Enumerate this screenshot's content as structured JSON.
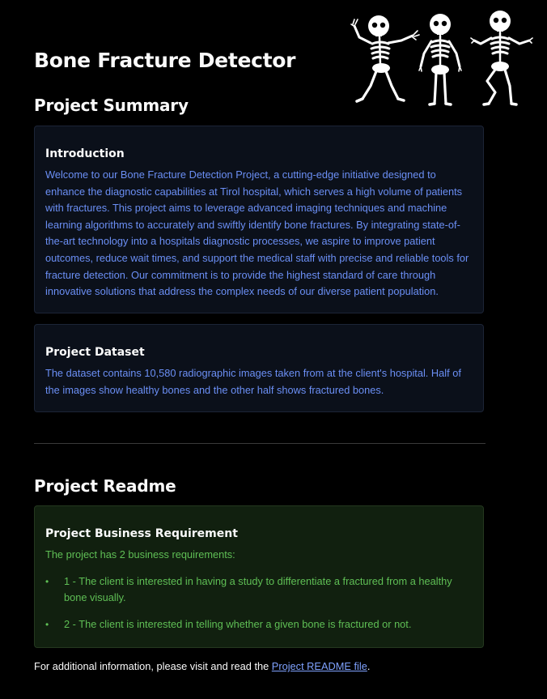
{
  "header": {
    "title": "Bone Fracture Detector",
    "image_icon": "dancing-skeletons-image"
  },
  "summary": {
    "heading": "Project Summary",
    "introduction": {
      "title": "Introduction",
      "text": "Welcome to our Bone Fracture Detection Project, a cutting-edge initiative designed to enhance the diagnostic capabilities at Tirol hospital, which serves a high volume of patients with fractures. This project aims to leverage advanced imaging techniques and machine learning algorithms to accurately and swiftly identify bone fractures. By integrating state-of-the-art technology into a hospitals diagnostic processes, we aspire to improve patient outcomes, reduce wait times, and support the medical staff with precise and reliable tools for fracture detection. Our commitment is to provide the highest standard of care through innovative solutions that address the complex needs of our diverse patient population."
    },
    "dataset": {
      "title": "Project Dataset",
      "text": "The dataset contains 10,580 radiographic images taken from at the client's hospital. Half of the images show healthy bones and the other half shows fractured bones."
    }
  },
  "readme": {
    "heading": "Project Readme",
    "requirements": {
      "title": "Project Business Requirement",
      "intro": "The project has 2 business requirements:",
      "items": [
        "1 - The client is interested in having a study to differentiate a fractured from a healthy bone visually.",
        "2 - The client is interested in telling whether a given bone is fractured or not."
      ]
    }
  },
  "footer": {
    "prefix": "For additional information, please visit and read the ",
    "link_text": "Project README file",
    "suffix": "."
  },
  "colors": {
    "background": "#000000",
    "info_text": "#6b8ff5",
    "success_text": "#5fbf55",
    "link": "#7fa2ff"
  }
}
